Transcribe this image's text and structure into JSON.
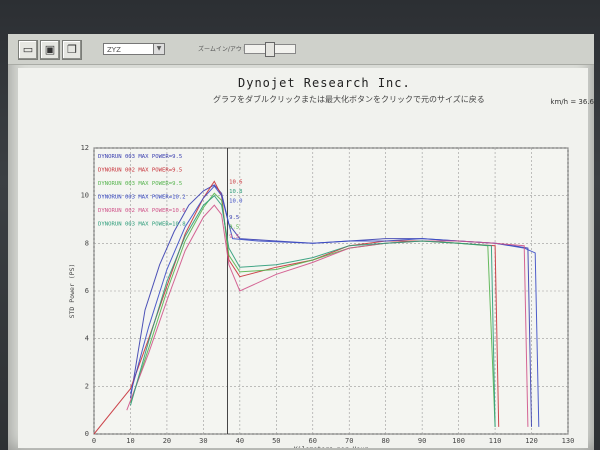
{
  "window": {
    "view_select": "ZYZ",
    "zoom_label": "ズームイン/アウト"
  },
  "header": {
    "title": "Dynojet Research Inc.",
    "subtitle": "グラフをダブルクリックまたは最大化ボタンをクリックで元のサイズに戻る",
    "readout": "km/h = 36.6"
  },
  "icons": {
    "open": "folder-icon",
    "save": "disk-icon",
    "copy": "copy-icon"
  },
  "chart_data": {
    "type": "line",
    "title": "Dynojet Research Inc.",
    "xlabel": "Kilometers per Hour",
    "ylabel": "STD Power (PS)",
    "xlim": [
      0,
      130
    ],
    "ylim": [
      0,
      12
    ],
    "xticks": [
      0,
      10,
      20,
      30,
      40,
      50,
      60,
      70,
      80,
      90,
      100,
      110,
      120,
      130
    ],
    "yticks": [
      0,
      2,
      4,
      6,
      8,
      10,
      12
    ],
    "grid": true,
    "legend_position": "top-left",
    "cursor_x": 36.6,
    "series": [
      {
        "name": "DYNORUN 003   MAX POWER=9.5",
        "color": "#3a3fb0",
        "points": [
          [
            10,
            1.5
          ],
          [
            14,
            5.2
          ],
          [
            18,
            7.1
          ],
          [
            22,
            8.5
          ],
          [
            26,
            9.6
          ],
          [
            30,
            10.2
          ],
          [
            33,
            10.45
          ],
          [
            35,
            10.1
          ],
          [
            37,
            8.8
          ],
          [
            40,
            8.2
          ],
          [
            50,
            8.1
          ],
          [
            60,
            8.0
          ],
          [
            70,
            8.1
          ],
          [
            80,
            8.2
          ],
          [
            90,
            8.2
          ],
          [
            100,
            8.1
          ],
          [
            110,
            8.0
          ],
          [
            115,
            7.9
          ],
          [
            119,
            7.8
          ],
          [
            120,
            0.3
          ]
        ]
      },
      {
        "name": "DYNORUN 002   MAX POWER=9.5",
        "color": "#c8323a",
        "points": [
          [
            0,
            0
          ],
          [
            10,
            1.9
          ],
          [
            15,
            4.0
          ],
          [
            20,
            6.2
          ],
          [
            25,
            8.4
          ],
          [
            30,
            9.9
          ],
          [
            33,
            10.6
          ],
          [
            35,
            10.0
          ],
          [
            37,
            7.3
          ],
          [
            40,
            6.6
          ],
          [
            50,
            7.0
          ],
          [
            60,
            7.3
          ],
          [
            70,
            7.9
          ],
          [
            80,
            8.1
          ],
          [
            90,
            8.1
          ],
          [
            100,
            8.0
          ],
          [
            105,
            7.95
          ],
          [
            110,
            7.9
          ],
          [
            111,
            0.3
          ]
        ]
      },
      {
        "name": "DYNORUN 003   MAX POWER=9.5",
        "color": "#56b44e",
        "points": [
          [
            10,
            1.3
          ],
          [
            15,
            3.6
          ],
          [
            20,
            6.0
          ],
          [
            25,
            8.1
          ],
          [
            30,
            9.5
          ],
          [
            33,
            10.1
          ],
          [
            35,
            9.8
          ],
          [
            37,
            7.5
          ],
          [
            40,
            6.8
          ],
          [
            50,
            6.9
          ],
          [
            60,
            7.3
          ],
          [
            70,
            7.8
          ],
          [
            80,
            8.0
          ],
          [
            90,
            8.1
          ],
          [
            100,
            8.0
          ],
          [
            108,
            7.9
          ],
          [
            110,
            0.3
          ]
        ]
      },
      {
        "name": "DYNORUN 003   MAX POWER=10.2",
        "color": "#3b4cc5",
        "points": [
          [
            10,
            1.7
          ],
          [
            15,
            4.5
          ],
          [
            20,
            6.9
          ],
          [
            25,
            8.7
          ],
          [
            30,
            9.9
          ],
          [
            33,
            10.4
          ],
          [
            35,
            10.0
          ],
          [
            38,
            8.2
          ],
          [
            45,
            8.1
          ],
          [
            60,
            8.0
          ],
          [
            70,
            8.1
          ],
          [
            80,
            8.1
          ],
          [
            90,
            8.2
          ],
          [
            100,
            8.1
          ],
          [
            110,
            8.0
          ],
          [
            118,
            7.8
          ],
          [
            121,
            7.6
          ],
          [
            122,
            0.3
          ]
        ]
      },
      {
        "name": "DYNORUN 002   MAX POWER=10.6",
        "color": "#d0548a",
        "points": [
          [
            9,
            1.0
          ],
          [
            15,
            3.4
          ],
          [
            20,
            5.6
          ],
          [
            25,
            7.7
          ],
          [
            30,
            9.1
          ],
          [
            33,
            9.6
          ],
          [
            35,
            9.2
          ],
          [
            37,
            7.1
          ],
          [
            40,
            6.0
          ],
          [
            50,
            6.7
          ],
          [
            60,
            7.2
          ],
          [
            70,
            7.8
          ],
          [
            80,
            8.0
          ],
          [
            90,
            8.1
          ],
          [
            100,
            8.1
          ],
          [
            110,
            8.0
          ],
          [
            118,
            7.9
          ],
          [
            119,
            0.3
          ]
        ]
      },
      {
        "name": "DYNORUN 003   MAX POWER=10.8",
        "color": "#2d9c7a",
        "points": [
          [
            10,
            1.2
          ],
          [
            15,
            3.9
          ],
          [
            20,
            6.4
          ],
          [
            25,
            8.3
          ],
          [
            30,
            9.6
          ],
          [
            33,
            10.0
          ],
          [
            35,
            9.6
          ],
          [
            37,
            7.8
          ],
          [
            40,
            7.0
          ],
          [
            50,
            7.1
          ],
          [
            60,
            7.4
          ],
          [
            70,
            7.9
          ],
          [
            80,
            8.0
          ],
          [
            90,
            8.1
          ],
          [
            100,
            8.0
          ],
          [
            109,
            7.9
          ],
          [
            110,
            0.3
          ]
        ]
      }
    ],
    "point_labels": [
      {
        "text": "10.6",
        "x": 36.5,
        "y": 10.6,
        "color": "#c8323a"
      },
      {
        "text": "10.8",
        "x": 36.5,
        "y": 10.2,
        "color": "#2d9c7a"
      },
      {
        "text": "10.0",
        "x": 36.5,
        "y": 9.8,
        "color": "#3b4cc5"
      },
      {
        "text": "9.5",
        "x": 36.5,
        "y": 9.1,
        "color": "#3a3fb0"
      },
      {
        "text": "9.5",
        "x": 36.5,
        "y": 8.7,
        "color": "#56b44e"
      },
      {
        "text": "9.5",
        "x": 36.5,
        "y": 8.3,
        "color": "#d0548a"
      }
    ]
  }
}
